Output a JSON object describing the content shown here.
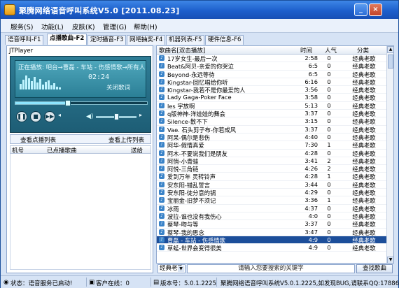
{
  "window": {
    "title": "聚腾网络语音呼叫系统V5.0 [2011.08.23]",
    "min": "_",
    "close": "×"
  },
  "menu": [
    "服务(S)",
    "功能(L)",
    "皮肤(K)",
    "管理(G)",
    "帮助(H)"
  ],
  "tabs": [
    "语音呼叫-F1",
    "点播歌曲-F2",
    "定时播音-F3",
    "网吧抽奖-F4",
    "机器列表-F5",
    "硬件信息-F6"
  ],
  "player": {
    "title": "JTPlayer",
    "now_playing": "正在播放: 吧台→曹磊 - 车站 - 伤感情歌→所有人",
    "time": "02:24",
    "close_lyrics": "关闭歌词",
    "progress": 0.4
  },
  "left": {
    "view_vod": "查看点播列表",
    "view_upload": "查看上传列表",
    "col_machine": "机号",
    "col_song": "已点播歌曲",
    "col_send": "送给"
  },
  "list": {
    "col_name": "歌曲名[双击播放]",
    "col_time": "时间",
    "col_pop": "人气",
    "col_cat": "分类",
    "rows": [
      {
        "name": "17岁女生-最后一次",
        "time": "2:58",
        "pop": "0",
        "cat": "经典老歌"
      },
      {
        "name": "Beat&阿贝-亲爱的你哭泣",
        "time": "6:5",
        "pop": "0",
        "cat": "经典老歌"
      },
      {
        "name": "Beyond-永远等待",
        "time": "6:5",
        "pop": "0",
        "cat": "经典老歌"
      },
      {
        "name": "Kingstar-回忆唱给你听",
        "time": "6:16",
        "pop": "0",
        "cat": "经典老歌"
      },
      {
        "name": "Kingstar-我若不是你最爱的人",
        "time": "3:56",
        "pop": "0",
        "cat": "经典老歌"
      },
      {
        "name": "Lady Gaga-Poker Face",
        "time": "3:58",
        "pop": "0",
        "cat": "经典老歌"
      },
      {
        "name": "les 宇放啊",
        "time": "5:13",
        "pop": "0",
        "cat": "经典老歌"
      },
      {
        "name": "q版神神-洋娃娃的舞会",
        "time": "3:37",
        "pop": "0",
        "cat": "经典老歌"
      },
      {
        "name": "Silence-散不下",
        "time": "3:15",
        "pop": "0",
        "cat": "经典老歌"
      },
      {
        "name": "Vae. 石头剪子布-你若成风",
        "time": "3:37",
        "pop": "0",
        "cat": "经典老歌"
      },
      {
        "name": "阿呆-偶尔是悲伤",
        "time": "4:40",
        "pop": "0",
        "cat": "经典老歌"
      },
      {
        "name": "阿华-假情真爱",
        "time": "7:30",
        "pop": "1",
        "cat": "经典老歌"
      },
      {
        "name": "阿木-不要说我们是朋友",
        "time": "4:28",
        "pop": "0",
        "cat": "经典老歌"
      },
      {
        "name": "阿悄-小青蛙",
        "time": "3:41",
        "pop": "2",
        "cat": "经典老歌"
      },
      {
        "name": "阿悦-三角链",
        "time": "4:26",
        "pop": "2",
        "cat": "经典老歌"
      },
      {
        "name": "爱到万年 灵转铃声",
        "time": "4:28",
        "pop": "1",
        "cat": "经典老歌"
      },
      {
        "name": "安东阳-错乱誓言",
        "time": "3:44",
        "pop": "0",
        "cat": "经典老歌"
      },
      {
        "name": "安东阳-徒分意的锅",
        "time": "4:29",
        "pop": "0",
        "cat": "经典老歌"
      },
      {
        "name": "宝丽金-旧梦不须记",
        "time": "3:36",
        "pop": "1",
        "cat": "经典老歌"
      },
      {
        "name": "冰雨",
        "time": "4:37",
        "pop": "0",
        "cat": "经典老歌"
      },
      {
        "name": "波拉-谁也没有我伤心",
        "time": "4:0",
        "pop": "0",
        "cat": "经典老歌"
      },
      {
        "name": "蔡琴-吻与等",
        "time": "3:37",
        "pop": "0",
        "cat": "经典老歌"
      },
      {
        "name": "蔡琴-我的思念",
        "time": "3:47",
        "pop": "0",
        "cat": "经典老歌"
      },
      {
        "name": "曹磊 - 车站 - 伤感情歌",
        "time": "4:9",
        "pop": "0",
        "cat": "经典老歌",
        "selected": true
      },
      {
        "name": "草蜢-世界会变得很美",
        "time": "4:9",
        "pop": "0",
        "cat": "经典老歌"
      }
    ]
  },
  "search": {
    "category": "经典老歌",
    "placeholder": "请输入您要搜索的关键字",
    "button": "查找歌曲"
  },
  "status": {
    "state": "状态：语音服务已启动!",
    "online": "客户在线：0",
    "version": "版本号：5.0.1.2225",
    "marquee": "聚腾网络语音呼叫系统V5.0.1.2225,如发现BUG,请联系QQ:178863288"
  }
}
